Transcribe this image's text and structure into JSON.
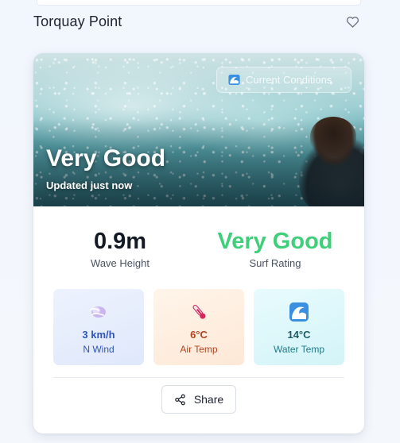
{
  "header": {
    "title": "Torquay Point",
    "favorite_icon": "heart-outline-icon"
  },
  "hero": {
    "badge_icon": "wave-icon",
    "badge_label": "Current Conditions",
    "rating": "Very Good",
    "updated": "Updated just now"
  },
  "stats": {
    "wave_height": {
      "value": "0.9m",
      "label": "Wave Height"
    },
    "surf_rating": {
      "value": "Very Good",
      "label": "Surf Rating",
      "color": "#3fcf7a"
    }
  },
  "tiles": [
    {
      "icon": "wind-icon",
      "value": "3 km/h",
      "label": "N Wind"
    },
    {
      "icon": "thermometer-icon",
      "value": "6°C",
      "label": "Air Temp"
    },
    {
      "icon": "wave-icon",
      "value": "14°C",
      "label": "Water Temp"
    }
  ],
  "share": {
    "icon": "share-icon",
    "label": "Share"
  }
}
